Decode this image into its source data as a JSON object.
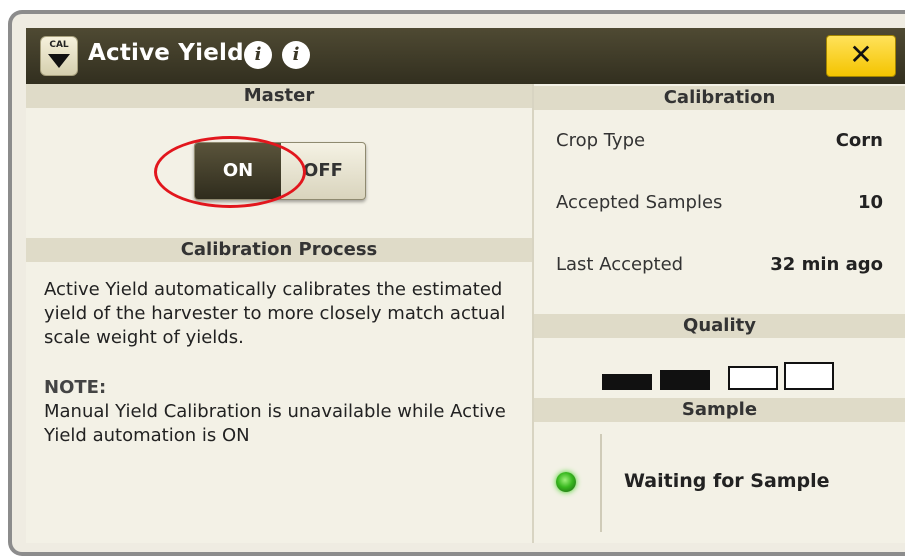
{
  "window": {
    "cal_label": "CAL",
    "title": "Active Yield",
    "info_glyph_1": "i",
    "info_glyph_2": "i",
    "close_label": "✕"
  },
  "master": {
    "header": "Master",
    "toggle": {
      "on_label": "ON",
      "off_label": "OFF",
      "selected": "ON"
    }
  },
  "process": {
    "header": "Calibration Process",
    "description": "Active Yield automatically calibrates the estimated yield of the harvester to more closely match actual scale weight of yields.",
    "note_label": "NOTE:",
    "note_text": "Manual Yield Calibration is unavailable while Active Yield automation is ON"
  },
  "calibration": {
    "header": "Calibration",
    "rows": [
      {
        "label": "Crop Type",
        "value": "Corn"
      },
      {
        "label": "Accepted Samples",
        "value": "10"
      },
      {
        "label": "Last Accepted",
        "value": "32 min ago"
      }
    ]
  },
  "quality": {
    "header": "Quality",
    "level": 2,
    "max": 4
  },
  "sample": {
    "header": "Sample",
    "status": "Waiting for Sample",
    "indicator_color": "#38b81f"
  },
  "colors": {
    "title_bar": "#3a3626",
    "close_button": "#f4c400",
    "highlight_ring": "#e2161d"
  }
}
